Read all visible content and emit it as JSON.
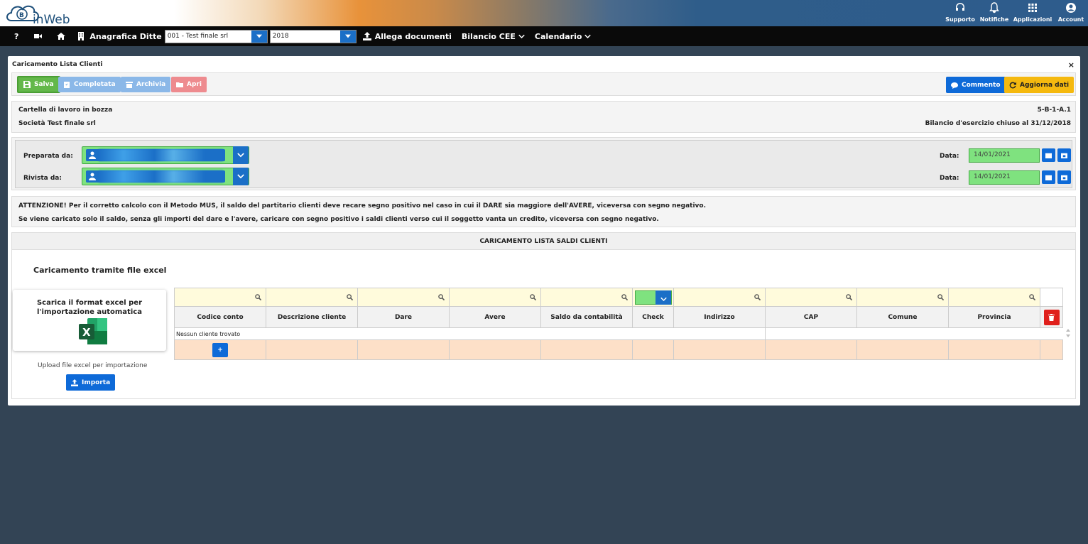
{
  "brand": {
    "name": "inWeb"
  },
  "top_actions": [
    {
      "label": "Supporto",
      "icon": "headset-icon"
    },
    {
      "label": "Notifiche",
      "icon": "bell-icon"
    },
    {
      "label": "Applicazioni",
      "icon": "grid-icon"
    },
    {
      "label": "Account",
      "icon": "user-circle-icon"
    }
  ],
  "nav": {
    "help": "?",
    "anagrafica": "Anagrafica Ditte",
    "company_select": "001 - Test finale srl",
    "year_select": "2018",
    "allega": "Allega documenti",
    "bilancio": "Bilancio CEE",
    "calendario": "Calendario"
  },
  "panel": {
    "title": "Caricamento Lista Clienti",
    "close": "×"
  },
  "toolbar": {
    "salva": "Salva",
    "completata": "Completata",
    "archivia": "Archivia",
    "apri": "Apri",
    "commento": "Commento",
    "aggiorna": "Aggiorna dati"
  },
  "info": {
    "status": "Cartella di lavoro in bozza",
    "code": "5-B-1-A.1",
    "company": "Società Test finale srl",
    "bilancio": "Bilancio d'esercizio chiuso al 31/12/2018"
  },
  "review": {
    "preparata_label": "Preparata da:",
    "rivista_label": "Rivista da:",
    "data_label": "Data:",
    "preparata_date": "14/01/2021",
    "rivista_date": "14/01/2021"
  },
  "warnings": {
    "line1": "ATTENZIONE! Per il corretto calcolo con il Metodo MUS, il saldo del partitario clienti deve recare segno positivo nel caso in cui il DARE sia maggiore dell'AVERE, viceversa con segno negativo.",
    "line2": "Se viene caricato solo il saldo, senza gli importi del dare e l'avere, caricare con segno positivo i saldi clienti verso cui il soggetto vanta un credito, viceversa con segno negativo."
  },
  "section": {
    "title": "CARICAMENTO LISTA SALDI CLIENTI",
    "upload_title": "Caricamento tramite file excel",
    "excel_card": "Scarica il format excel per l'importazione automatica",
    "upload_label": "Upload file excel per importazione",
    "importa": "Importa"
  },
  "table": {
    "columns": [
      "Codice conto",
      "Descrizione cliente",
      "Dare",
      "Avere",
      "Saldo da contabilità",
      "Check",
      "Indirizzo",
      "CAP",
      "Comune",
      "Provincia"
    ],
    "empty": "Nessun cliente trovato"
  },
  "colors": {
    "accent_blue": "#0e6ad8",
    "green": "#63b84a",
    "yellow": "#f5b90f",
    "red": "#e0201c",
    "background": "#334455"
  }
}
